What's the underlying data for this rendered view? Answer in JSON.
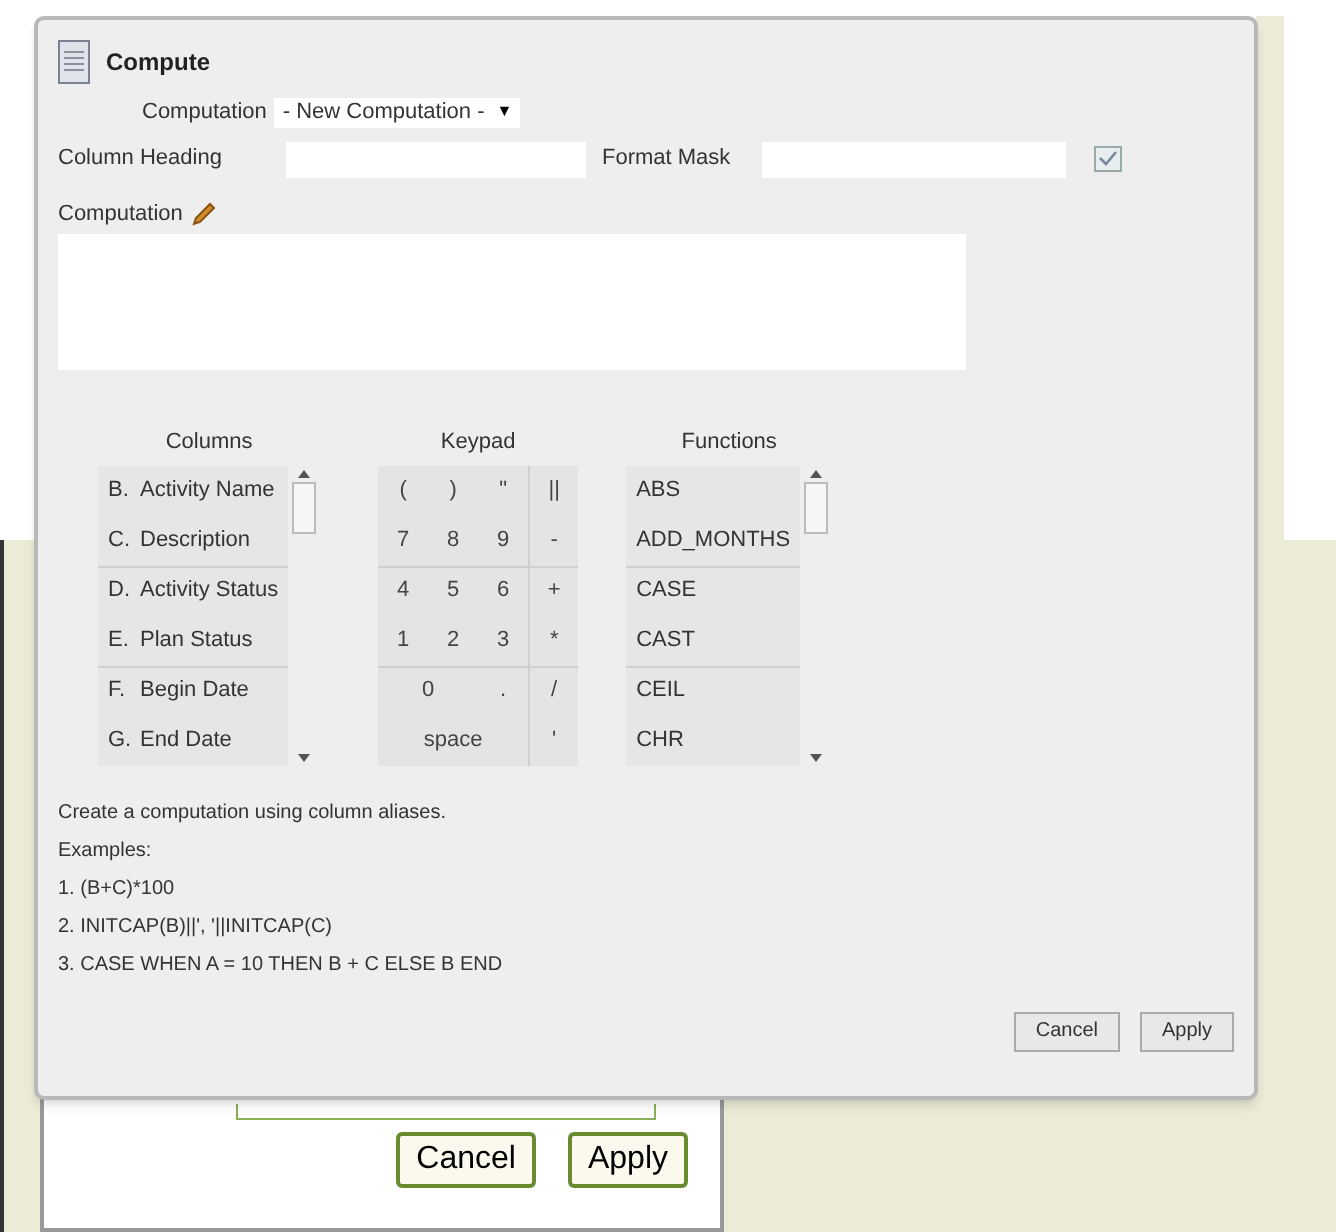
{
  "dialog": {
    "title": "Compute",
    "computation_select": {
      "label": "Computation",
      "value": "- New Computation -",
      "arrow": "▼"
    },
    "column_heading": {
      "label": "Column Heading"
    },
    "format_mask": {
      "label": "Format Mask"
    },
    "computation_editor": {
      "label": "Computation"
    },
    "columns": {
      "title": "Columns",
      "items": [
        {
          "alias": "B.",
          "name": "Activity Name"
        },
        {
          "alias": "C.",
          "name": "Description"
        },
        {
          "alias": "D.",
          "name": "Activity Status"
        },
        {
          "alias": "E.",
          "name": "Plan Status"
        },
        {
          "alias": "F.",
          "name": "Begin Date"
        },
        {
          "alias": "G.",
          "name": "End Date"
        }
      ]
    },
    "keypad": {
      "title": "Keypad",
      "rows": [
        [
          {
            "label": "("
          },
          {
            "label": ")"
          },
          {
            "label": "\""
          },
          {
            "label": "||"
          }
        ],
        [
          {
            "label": "7"
          },
          {
            "label": "8"
          },
          {
            "label": "9"
          },
          {
            "label": "-"
          }
        ],
        [
          {
            "label": "4"
          },
          {
            "label": "5"
          },
          {
            "label": "6"
          },
          {
            "label": "+"
          }
        ],
        [
          {
            "label": "1"
          },
          {
            "label": "2"
          },
          {
            "label": "3"
          },
          {
            "label": "*"
          }
        ],
        [
          {
            "label": "0"
          },
          {},
          {
            "label": "."
          },
          {
            "label": "/"
          }
        ],
        [
          {
            "label": "space"
          },
          {},
          {},
          {
            "label": "'"
          }
        ]
      ]
    },
    "functions": {
      "title": "Functions",
      "items": [
        "ABS",
        "ADD_MONTHS",
        "CASE",
        "CAST",
        "CEIL",
        "CHR"
      ]
    },
    "help": [
      "Create a computation using column aliases.",
      "Examples:",
      "1. (B+C)*100",
      "2. INITCAP(B)||', '||INITCAP(C)",
      "3. CASE WHEN A = 10 THEN B + C ELSE B END"
    ],
    "buttons": [
      "Cancel",
      "Apply"
    ]
  },
  "background_panel": {
    "buttons": [
      "Cancel",
      "Apply"
    ]
  }
}
